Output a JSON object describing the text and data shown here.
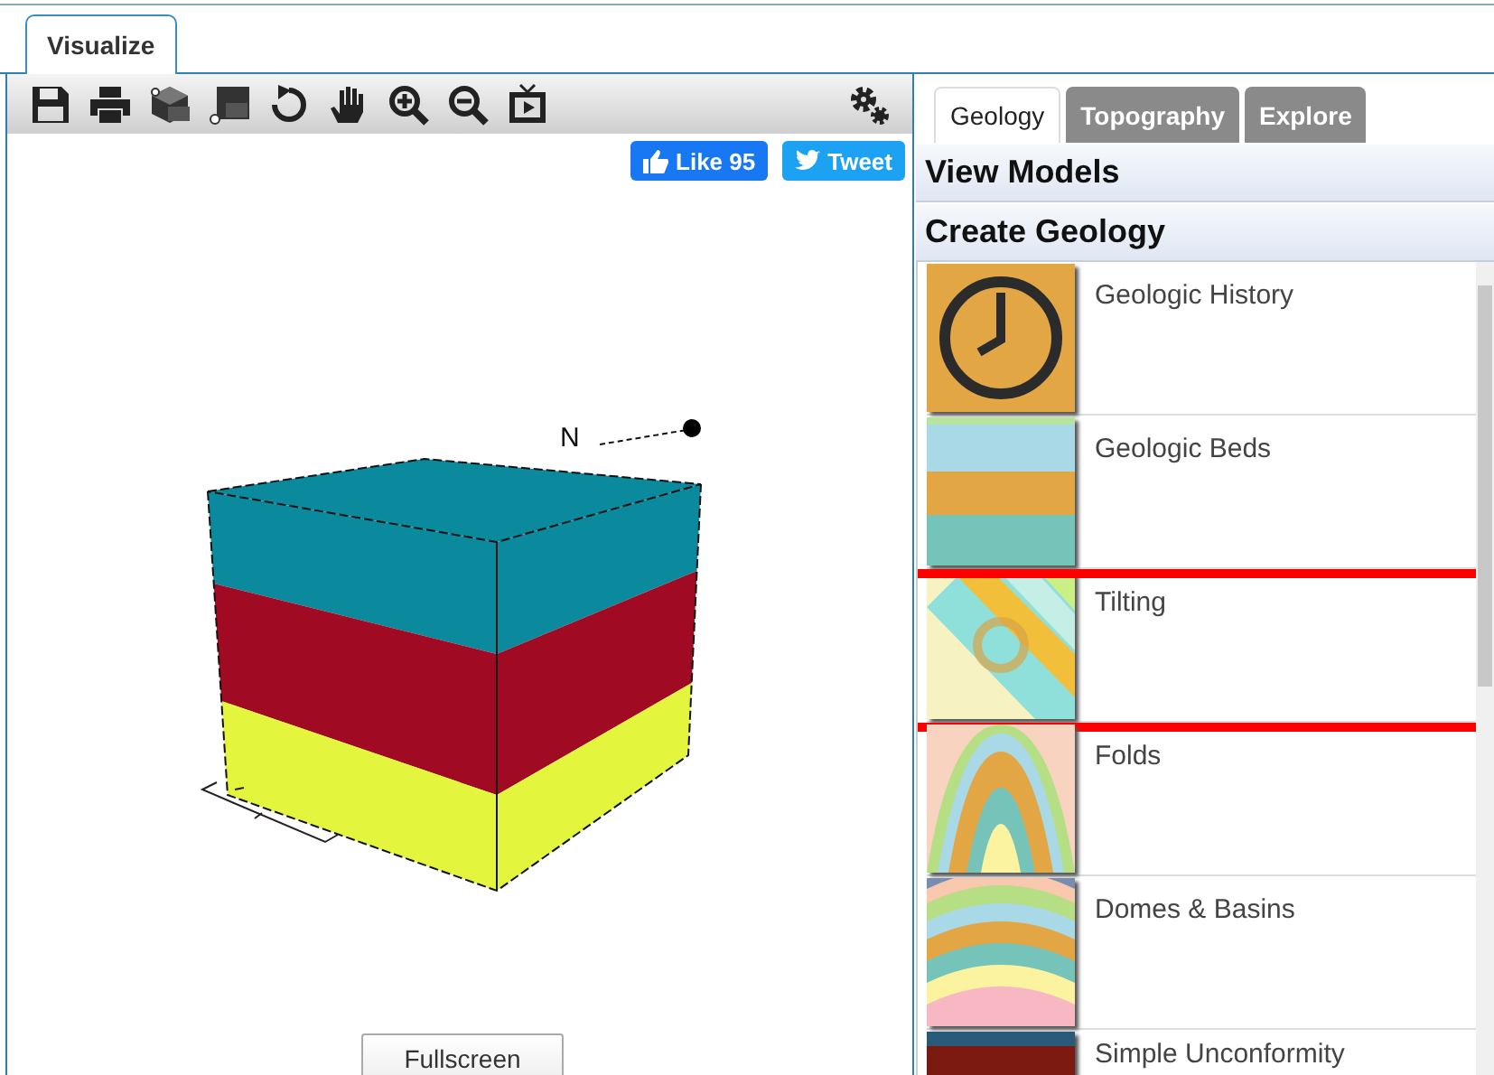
{
  "main_tab": {
    "label": "Visualize",
    "selected": true
  },
  "toolbar": {
    "tools": [
      {
        "kind": "save"
      },
      {
        "kind": "print"
      },
      {
        "kind": "cube"
      },
      {
        "kind": "plane"
      },
      {
        "kind": "rotate"
      },
      {
        "kind": "pan"
      },
      {
        "kind": "zoomin"
      },
      {
        "kind": "zoomout"
      },
      {
        "kind": "tv"
      }
    ]
  },
  "social": {
    "like": "Like 95",
    "tweet": "Tweet"
  },
  "viewer": {
    "compass_label": "N",
    "layers": [
      {
        "color": "#0b8a9e"
      },
      {
        "color": "#a00a23"
      },
      {
        "color": "#e3f53c"
      }
    ]
  },
  "fullscreen_button": "Fullscreen",
  "side_tabs": [
    {
      "label": "Geology",
      "selected": true
    },
    {
      "label": "Topography",
      "selected": false
    },
    {
      "label": "Explore",
      "selected": false
    }
  ],
  "sections": [
    "View Models",
    "Create Geology"
  ],
  "geology_items": [
    {
      "label": "Geologic History",
      "kind": "history",
      "highlighted": false
    },
    {
      "label": "Geologic Beds",
      "kind": "beds",
      "highlighted": false
    },
    {
      "label": "Tilting",
      "kind": "tilting",
      "highlighted": true
    },
    {
      "label": "Folds",
      "kind": "folds",
      "highlighted": false
    },
    {
      "label": "Domes & Basins",
      "kind": "domes",
      "highlighted": false
    },
    {
      "label": "Simple Unconformity",
      "kind": "unconformity",
      "highlighted": false
    }
  ]
}
